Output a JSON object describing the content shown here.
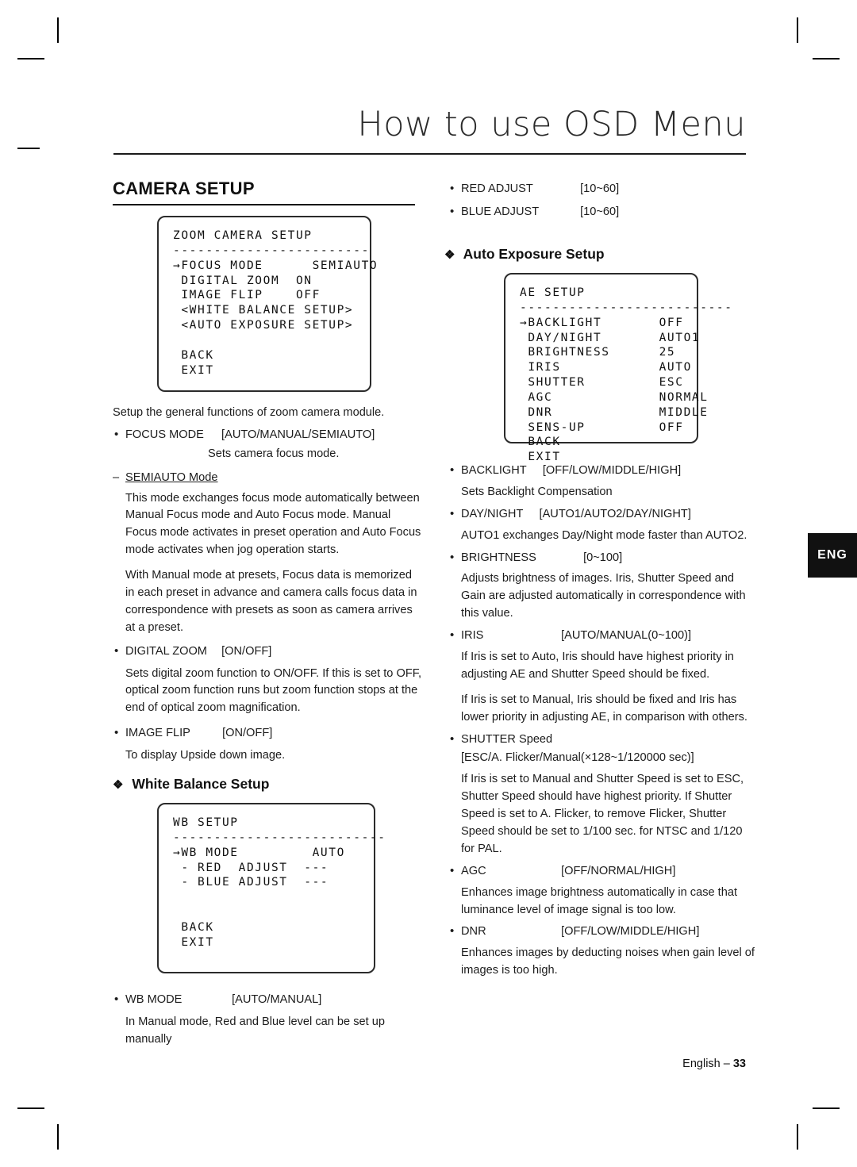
{
  "header": {
    "title": "How to use OSD Menu"
  },
  "section": {
    "title": "CAMERA SETUP"
  },
  "osd_camera_setup": {
    "title": "ZOOM CAMERA SETUP",
    "divider": "------------------------",
    "lines": [
      "→FOCUS MODE      SEMIAUTO",
      " DIGITAL ZOOM  ON",
      " IMAGE FLIP    OFF",
      " <WHITE BALANCE SETUP>",
      " <AUTO EXPOSURE SETUP>"
    ],
    "back": " BACK",
    "exit": " EXIT"
  },
  "osd_wb_setup": {
    "title": "WB SETUP",
    "divider": "--------------------------",
    "lines": [
      "→WB MODE         AUTO",
      " - RED  ADJUST  ---",
      " - BLUE ADJUST  ---"
    ],
    "back": " BACK",
    "exit": " EXIT"
  },
  "osd_ae_setup": {
    "title": "AE SETUP",
    "divider": "--------------------------",
    "lines": [
      "→BACKLIGHT       OFF",
      " DAY/NIGHT       AUTO1",
      " BRIGHTNESS      25",
      " IRIS            AUTO",
      " SHUTTER         ESC",
      " AGC             NORMAL",
      " DNR             MIDDLE",
      " SENS-UP         OFF"
    ],
    "back": " BACK",
    "exit": " EXIT"
  },
  "left_column": {
    "intro": "Setup the general functions of zoom camera module.",
    "focus_mode": {
      "label": "FOCUS MODE",
      "value": "[AUTO/MANUAL/SEMIAUTO]",
      "desc": "Sets camera focus mode."
    },
    "semiauto": {
      "heading": "SEMIAUTO Mode",
      "para1": "This mode exchanges focus mode automatically between Manual Focus mode and Auto Focus mode. Manual Focus mode activates in preset operation and Auto Focus mode activates when jog operation starts.",
      "para2": "With Manual mode at presets, Focus data is memorized in each preset in advance and camera calls focus data in correspondence with presets as soon as camera arrives at a preset."
    },
    "digital_zoom": {
      "label": "DIGITAL ZOOM",
      "value": "[ON/OFF]",
      "desc": "Sets digital zoom function to ON/OFF. If this is set to OFF, optical zoom function runs but zoom function stops at the end of optical zoom magnification."
    },
    "image_flip": {
      "label": "IMAGE FLIP",
      "value": "[ON/OFF]",
      "desc": "To display Upside down image."
    },
    "wb_subhead": "White Balance Setup",
    "wb_mode": {
      "label": "WB MODE",
      "value": "[AUTO/MANUAL]",
      "desc": "In Manual mode, Red and Blue level can be set up manually"
    }
  },
  "right_column": {
    "red_adjust": {
      "label": "RED ADJUST",
      "value": "[10~60]"
    },
    "blue_adjust": {
      "label": "BLUE ADJUST",
      "value": "[10~60]"
    },
    "ae_subhead": "Auto Exposure Setup",
    "backlight": {
      "label": "BACKLIGHT",
      "value": "[OFF/LOW/MIDDLE/HIGH]",
      "desc": "Sets Backlight Compensation"
    },
    "day_night": {
      "label": "DAY/NIGHT",
      "value": "[AUTO1/AUTO2/DAY/NIGHT]",
      "desc": "AUTO1 exchanges Day/Night mode faster than AUTO2."
    },
    "brightness": {
      "label": "BRIGHTNESS",
      "value": "[0~100]",
      "desc": "Adjusts brightness of images. Iris, Shutter Speed and Gain are adjusted automatically in correspondence with this value."
    },
    "iris": {
      "label": "IRIS",
      "value": "[AUTO/MANUAL(0~100)]",
      "desc1": "If Iris is set to Auto, Iris should have highest priority in adjusting AE and Shutter Speed should be fixed.",
      "desc2": "If Iris is set to Manual, Iris should be fixed and Iris has lower priority in adjusting AE, in comparison with others."
    },
    "shutter": {
      "label": "SHUTTER Speed",
      "value": "[ESC/A. Flicker/Manual(×128~1/120000 sec)]",
      "desc": "If Iris is set to Manual and Shutter Speed is set to ESC, Shutter Speed should have highest priority. If Shutter Speed is set to A. Flicker, to remove Flicker, Shutter Speed should be set to 1/100 sec. for NTSC and 1/120 for PAL."
    },
    "agc": {
      "label": "AGC",
      "value": "[OFF/NORMAL/HIGH]",
      "desc": "Enhances image brightness automatically in case that luminance level of image signal is too low."
    },
    "dnr": {
      "label": "DNR",
      "value": "[OFF/LOW/MIDDLE/HIGH]",
      "desc": "Enhances images by deducting noises when gain level of images is too high."
    }
  },
  "side_tab": {
    "label": "ENG"
  },
  "footer": {
    "text": "English – ",
    "page": "33"
  }
}
